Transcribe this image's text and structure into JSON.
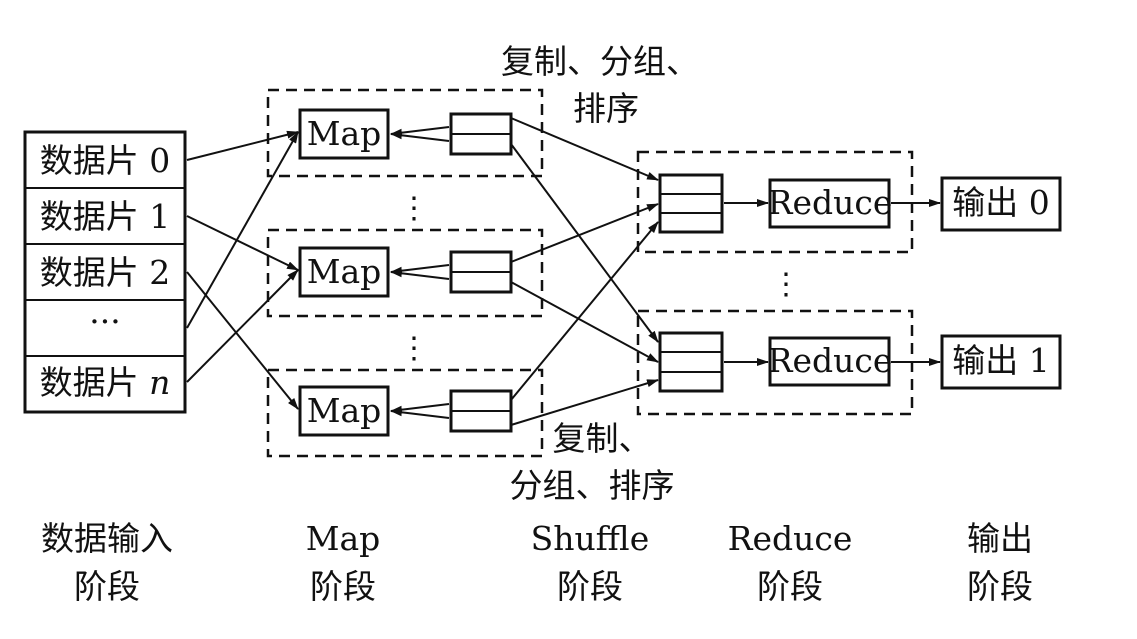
{
  "input_splits": {
    "rows": [
      "数据片 0",
      "数据片 1",
      "数据片 2",
      "···"
    ],
    "last_prefix": "数据片 ",
    "last_var": "n"
  },
  "map_label": "Map",
  "reduce_label": "Reduce",
  "outputs": [
    "输出 0",
    "输出 1"
  ],
  "annotations": {
    "top_line1": "复制、分组、",
    "top_line2": "排序",
    "bottom_line1": "复制、",
    "bottom_line2": "分组、排序"
  },
  "ellipsis": "⋮",
  "stages": [
    {
      "line1": "数据输入",
      "line2": "阶段"
    },
    {
      "line1": "Map",
      "line2": "阶段"
    },
    {
      "line1": "Shuffle",
      "line2": "阶段"
    },
    {
      "line1": "Reduce",
      "line2": "阶段"
    },
    {
      "line1": "输出",
      "line2": "阶段"
    }
  ]
}
